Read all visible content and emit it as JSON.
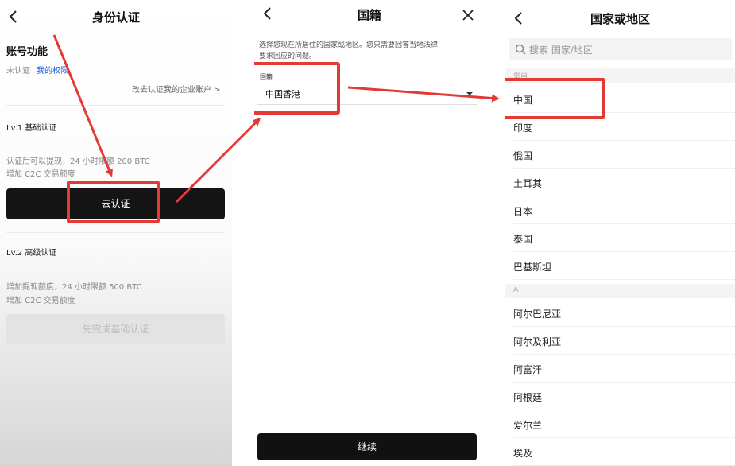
{
  "panel1": {
    "title": "身份认证",
    "account_section": "账号功能",
    "status": "未认证",
    "my_rights": "我的权限",
    "enterprise_link": "改去认证我的企业账户 >",
    "lv1": {
      "title": "Lv.1 基础认证",
      "line1": "认证后可以提现，24 小时限额 200 BTC",
      "line2": "增加 C2C 交易额度",
      "button": "去认证"
    },
    "lv2": {
      "title": "Lv.2 高级认证",
      "line1": "增加提现额度，24 小时限额 500 BTC",
      "line2": "增加 C2C 交易额度",
      "button": "先完成基础认证"
    }
  },
  "panel2": {
    "title": "国籍",
    "instruction_line1": "选择您现在所居住的国家或地区。您只需要回答当地法律",
    "instruction_line2": "要求回应的问题。",
    "field_label": "国籍",
    "field_value": "中国香港",
    "continue_button": "继续"
  },
  "panel3": {
    "title": "国家或地区",
    "search_placeholder": "搜索 国家/地区",
    "common_header": "常用",
    "common_countries": [
      "中国",
      "印度",
      "俄国",
      "土耳其",
      "日本",
      "泰国",
      "巴基斯坦"
    ],
    "a_header": "A",
    "a_countries": [
      "阿尔巴尼亚",
      "阿尔及利亚",
      "阿富汗",
      "阿根廷",
      "爱尔兰",
      "埃及"
    ]
  },
  "colors": {
    "highlight_red": "#e53935",
    "link_blue": "#1e5ed9",
    "button_dark": "#141414"
  },
  "icons": [
    "back-arrow-icon",
    "close-icon",
    "search-icon",
    "dropdown-caret-icon"
  ]
}
